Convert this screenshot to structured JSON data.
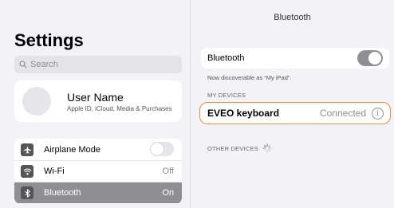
{
  "sidebar": {
    "title": "Settings",
    "search_placeholder": "Search",
    "profile": {
      "name": "User Name",
      "subtitle": "Apple ID, iCloud, Media & Purchases"
    },
    "items": [
      {
        "label": "Airplane Mode",
        "icon": "airplane-icon",
        "control": "toggle",
        "state": "off"
      },
      {
        "label": "Wi-Fi",
        "icon": "wifi-icon",
        "value": "Off"
      },
      {
        "label": "Bluetooth",
        "icon": "bluetooth-icon",
        "value": "On",
        "selected": true
      }
    ]
  },
  "panel": {
    "title": "Bluetooth",
    "bluetooth_label": "Bluetooth",
    "bluetooth_toggle": "on",
    "discoverable_text": "Now discoverable as “My iPad”.",
    "my_devices_label": "MY DEVICES",
    "devices": [
      {
        "name": "EVEO keyboard",
        "status": "Connected"
      }
    ],
    "other_devices_label": "OTHER DEVICES"
  },
  "colors": {
    "highlight_border": "#f08a3c",
    "selected_row": "#8e8e93"
  }
}
